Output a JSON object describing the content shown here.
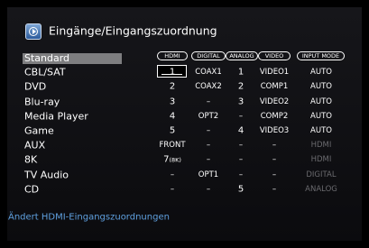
{
  "screen": {
    "title": "Eingänge/Eingangszuordnung",
    "hint": "Ändert HDMI-Eingangszuordnungen"
  },
  "table": {
    "columns": [
      "HDMI",
      "DIGITAL",
      "ANALOG",
      "VIDEO",
      "INPUT MODE"
    ],
    "header_row_label": "Standard",
    "rows": [
      {
        "name": "CBL/SAT",
        "hdmi": "1",
        "digital": "COAX1",
        "analog": "1",
        "video": "VIDEO1",
        "mode": "AUTO"
      },
      {
        "name": "DVD",
        "hdmi": "2",
        "digital": "COAX2",
        "analog": "2",
        "video": "COMP1",
        "mode": "AUTO"
      },
      {
        "name": "Blu-ray",
        "hdmi": "3",
        "digital": "–",
        "analog": "3",
        "video": "VIDEO2",
        "mode": "AUTO"
      },
      {
        "name": "Media Player",
        "hdmi": "4",
        "digital": "OPT2",
        "analog": "–",
        "video": "COMP2",
        "mode": "AUTO"
      },
      {
        "name": "Game",
        "hdmi": "5",
        "digital": "–",
        "analog": "4",
        "video": "VIDEO3",
        "mode": "AUTO"
      },
      {
        "name": "AUX",
        "hdmi": "FRONT",
        "digital": "–",
        "analog": "–",
        "video": "–",
        "mode": "HDMI"
      },
      {
        "name": "8K",
        "hdmi": "7",
        "hdmi_sub": "(8K)",
        "digital": "–",
        "analog": "–",
        "video": "–",
        "mode": "HDMI"
      },
      {
        "name": "TV Audio",
        "hdmi": "–",
        "digital": "OPT1",
        "analog": "–",
        "video": "–",
        "mode": "DIGITAL"
      },
      {
        "name": "CD",
        "hdmi": "–",
        "digital": "–",
        "analog": "5",
        "video": "–",
        "mode": "ANALOG"
      }
    ]
  }
}
